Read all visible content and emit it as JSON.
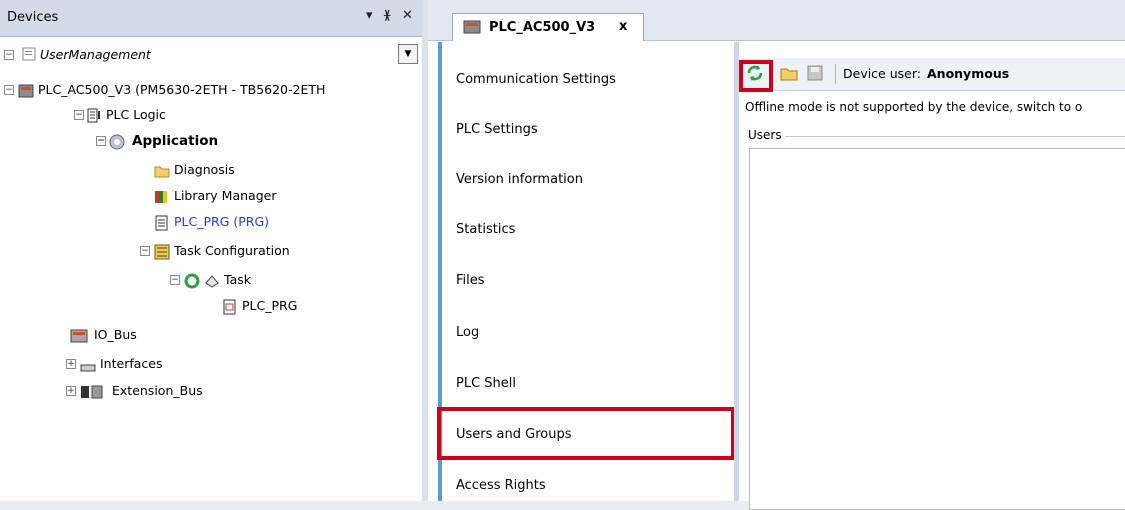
{
  "devices": {
    "title": "Devices",
    "buttons": [
      "▾",
      "ᚕ",
      "✕"
    ],
    "combo_value": "UserManagement",
    "tree": [
      {
        "label": "PLC_AC500_V3 (PM5630-2ETH - TB5620-2ETH"
      },
      {
        "label": "PLC Logic"
      },
      {
        "label": "Application"
      },
      {
        "label": "Diagnosis"
      },
      {
        "label": "Library Manager"
      },
      {
        "label": "PLC_PRG (PRG)"
      },
      {
        "label": "Task Configuration"
      },
      {
        "label": "Task"
      },
      {
        "label": "PLC_PRG"
      },
      {
        "label": "IO_Bus"
      },
      {
        "label": "Interfaces"
      },
      {
        "label": "Extension_Bus"
      }
    ]
  },
  "editor": {
    "tab_label": "PLC_AC500_V3",
    "tab_close": "x",
    "nav": [
      {
        "label": "Communication Settings"
      },
      {
        "label": "PLC Settings"
      },
      {
        "label": "Version information"
      },
      {
        "label": "Statistics"
      },
      {
        "label": "Files"
      },
      {
        "label": "Log"
      },
      {
        "label": "PLC Shell"
      },
      {
        "label": "Users and Groups"
      },
      {
        "label": "Access Rights"
      }
    ],
    "toolbar": {
      "device_user_label": "Device user:",
      "device_user_value": "Anonymous"
    },
    "offline_message": "Offline mode is not supported by the device, switch to o",
    "users_label": "Users"
  },
  "colors": {
    "highlight": "#d0021b",
    "nav_accent": "#5b9bd5",
    "link_blue": "#1a3cf5"
  }
}
